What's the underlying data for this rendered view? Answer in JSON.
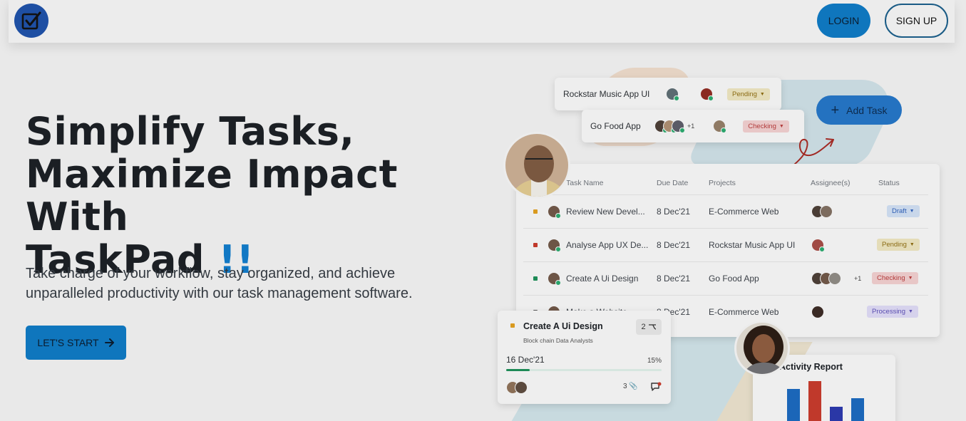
{
  "nav": {
    "login_label": "LOGIN",
    "signup_label": "SIGN UP"
  },
  "hero": {
    "title_line1": "Simplify Tasks,",
    "title_line2": "Maximize Impact With",
    "title_line3": "TaskPad",
    "title_accent": "!!",
    "subtitle": "Take charge of your workflow, stay organized, and achieve unparalleled productivity with our task management software.",
    "cta_label": "LET'S START"
  },
  "illustration": {
    "mini_cards": [
      {
        "project": "Rockstar Music App UI",
        "status": "Pending"
      },
      {
        "project": "Go Food App",
        "extra_count": "+1",
        "status": "Checking"
      }
    ],
    "add_task_label": "Add Task",
    "table": {
      "headers": [
        "Task Name",
        "Due Date",
        "Projects",
        "Assignee(s)",
        "Status"
      ],
      "rows": [
        {
          "task": "Review New Devel...",
          "due": "8 Dec'21",
          "project": "E-Commerce Web",
          "extra": "",
          "status": "Draft",
          "color": "#d99a1f"
        },
        {
          "task": "Analyse App UX De...",
          "due": "8 Dec'21",
          "project": "Rockstar Music App UI",
          "extra": "",
          "status": "Pending",
          "color": "#c0392b"
        },
        {
          "task": "Create A Ui Design",
          "due": "8 Dec'21",
          "project": "Go Food App",
          "extra": "+1",
          "status": "Checking",
          "color": "#1d8a56"
        },
        {
          "task": "Make a Website...",
          "due": "8 Dec'21",
          "project": "E-Commerce Web",
          "extra": "",
          "status": "Processing",
          "color": "#555555"
        }
      ]
    },
    "task_card": {
      "title": "Create A Ui Design",
      "subtitle": "Block chain Data Analysts",
      "subtasks": "2",
      "date": "16 Dec'21",
      "progress_label": "15%",
      "progress": 0.15,
      "attachments": "3"
    },
    "activity": {
      "title": "Activity Report",
      "bar_values": [
        0.8,
        0.95,
        0.42,
        0.6
      ],
      "bar_colors": [
        "#1b66b8",
        "#c0392b",
        "#2a37a6",
        "#1b66b8"
      ]
    }
  },
  "colors": {
    "primary": "#0f76bd",
    "accent_text": "#1178c4",
    "page_bg": "#e9e9e9"
  }
}
